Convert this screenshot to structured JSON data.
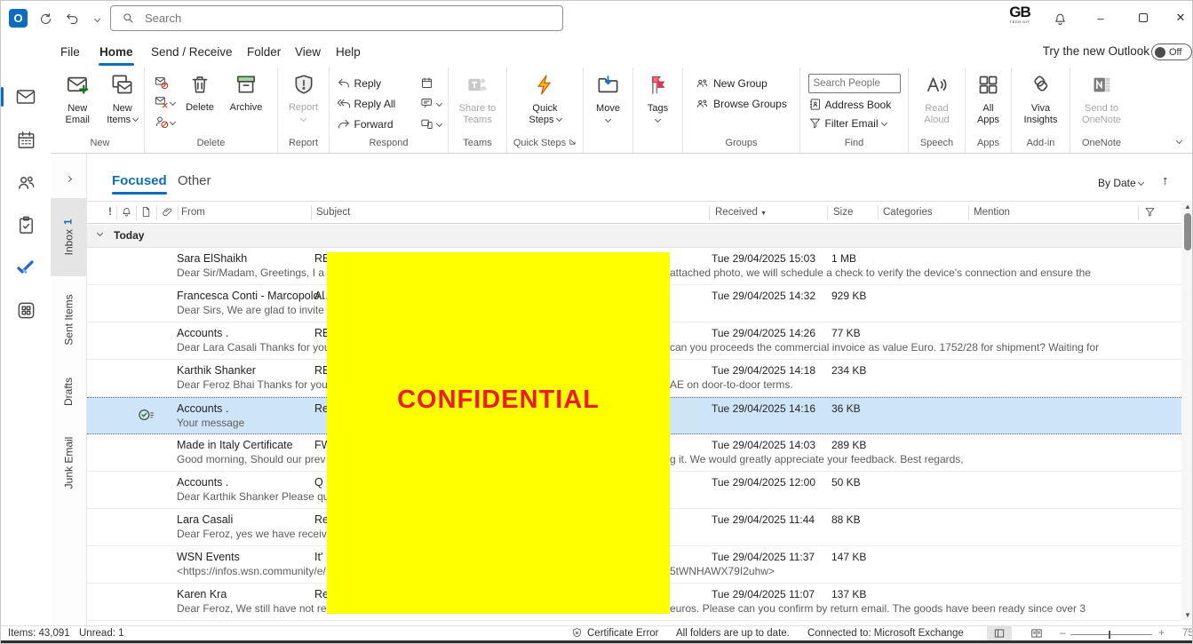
{
  "titlebar": {
    "search_placeholder": "Search",
    "logo_text": "GB",
    "logo_sub": "TECH GIT",
    "close_glyph": "✕",
    "minimize_glyph": "–"
  },
  "menu": {
    "tabs": [
      "File",
      "Home",
      "Send / Receive",
      "Folder",
      "View",
      "Help"
    ],
    "active_tab": "Home",
    "try_new_outlook": "Try the new Outlook",
    "toggle_state": "Off"
  },
  "ribbon": {
    "new_email": "New\nEmail",
    "new_items": "New\nItems",
    "delete_btn": "Delete",
    "archive": "Archive",
    "report": "Report",
    "reply": "Reply",
    "reply_all": "Reply All",
    "forward": "Forward",
    "share_teams": "Share to\nTeams",
    "quick_steps": "Quick\nSteps",
    "move": "Move",
    "tags": "Tags",
    "new_group": "New Group",
    "browse_groups": "Browse Groups",
    "search_people_placeholder": "Search People",
    "address_book": "Address Book",
    "filter_email": "Filter Email",
    "read_aloud": "Read\nAloud",
    "all_apps": "All\nApps",
    "viva_insights": "Viva\nInsights",
    "send_onenote": "Send to\nOneNote",
    "labels": {
      "new": "New",
      "delete": "Delete",
      "report": "Report",
      "respond": "Respond",
      "teams": "Teams",
      "quick_steps": "Quick Steps",
      "groups": "Groups",
      "find": "Find",
      "speech": "Speech",
      "apps": "Apps",
      "addin": "Add-in",
      "onenote": "OneNote"
    }
  },
  "folders": {
    "items": [
      {
        "label": "Inbox",
        "count": "1"
      },
      {
        "label": "Sent Items",
        "count": ""
      },
      {
        "label": "Drafts",
        "count": ""
      },
      {
        "label": "Junk Email",
        "count": ""
      }
    ]
  },
  "list": {
    "tab_focused": "Focused",
    "tab_other": "Other",
    "sort_label": "By Date",
    "columns": {
      "importance": "!",
      "from": "From",
      "subject": "Subject",
      "received": "Received",
      "size": "Size",
      "categories": "Categories",
      "mention": "Mention"
    },
    "group_today": "Today",
    "emails": [
      {
        "from": "Sara ElShaikh",
        "subject": "RE",
        "received": "Tue 29/04/2025 15:03",
        "size": "1 MB",
        "preview_left": "Dear Sir/Madam,   Greetings,   I a",
        "preview_right": "attached photo, we will schedule a check to verify the device's connection and ensure the"
      },
      {
        "from": "Francesca Conti - Marcopolo...",
        "subject": "Al",
        "received": "Tue 29/04/2025 14:32",
        "size": "929 KB",
        "preview_left": "Dear Sirs,  We are glad to invite y",
        "preview_right": ""
      },
      {
        "from": "Accounts .",
        "subject": "RE",
        "received": "Tue 29/04/2025 14:26",
        "size": "77 KB",
        "preview_left": "Dear Lara Casali  Thanks for your",
        "preview_right": "can you proceeds the commercial invoice as value Euro. 1752/28 for shipment?  Waiting for"
      },
      {
        "from": "Karthik Shanker",
        "subject": "RE",
        "received": "Tue 29/04/2025 14:18",
        "size": "234 KB",
        "preview_left": "Dear Feroz Bhai  Thanks for your",
        "preview_right": "AE on door-to-door terms."
      },
      {
        "from": "Accounts .",
        "subject": "Re",
        "received": "Tue 29/04/2025 14:16",
        "size": "36 KB",
        "preview_left": "Your message",
        "preview_right": ""
      },
      {
        "from": "Made in Italy Certificate",
        "subject": "FW",
        "received": "Tue 29/04/2025 14:03",
        "size": "289 KB",
        "preview_left": "Good morning,  Should our prev",
        "preview_right": "g it.  We would greatly appreciate your feedback.  Best regards,"
      },
      {
        "from": "Accounts .",
        "subject": "Q",
        "received": "Tue 29/04/2025 12:00",
        "size": "50 KB",
        "preview_left": "Dear Karthik Shanker  Please quo",
        "preview_right": ""
      },
      {
        "from": "Lara Casali",
        "subject": "Re",
        "received": "Tue 29/04/2025 11:44",
        "size": "88 KB",
        "preview_left": "Dear Feroz,  yes we have received",
        "preview_right": ""
      },
      {
        "from": "WSN Events",
        "subject": "It'",
        "received": "Tue 29/04/2025 11:37",
        "size": "147 KB",
        "preview_left": "<https://infos.wsn.community/e/",
        "preview_right": "5tWNHAWX79I2uhw>"
      },
      {
        "from": "Karen Kra",
        "subject": "Re",
        "received": "Tue 29/04/2025 11:07",
        "size": "137 KB",
        "preview_left": "Dear Feroz,  We still have not rec",
        "preview_right": "euros. Please can you confirm by return email. The goods have been ready since over 3"
      }
    ]
  },
  "overlay": {
    "text": "CONFIDENTIAL"
  },
  "status": {
    "items": "Items: 43,091",
    "unread": "Unread: 1",
    "certificate": "Certificate Error",
    "folders_status": "All folders are up to date.",
    "connected": "Connected to: Microsoft Exchange",
    "zoom_minus": "–",
    "zoom_plus": "+",
    "zoom_value": "75"
  },
  "colors": {
    "accent": "#0f6cbd",
    "selection_bg": "#cee5f7",
    "overlay_bg": "#ffff00",
    "overlay_text": "#ed1c24",
    "reply_purple": "#a43fb1",
    "forward_blue": "#0b78d1"
  }
}
